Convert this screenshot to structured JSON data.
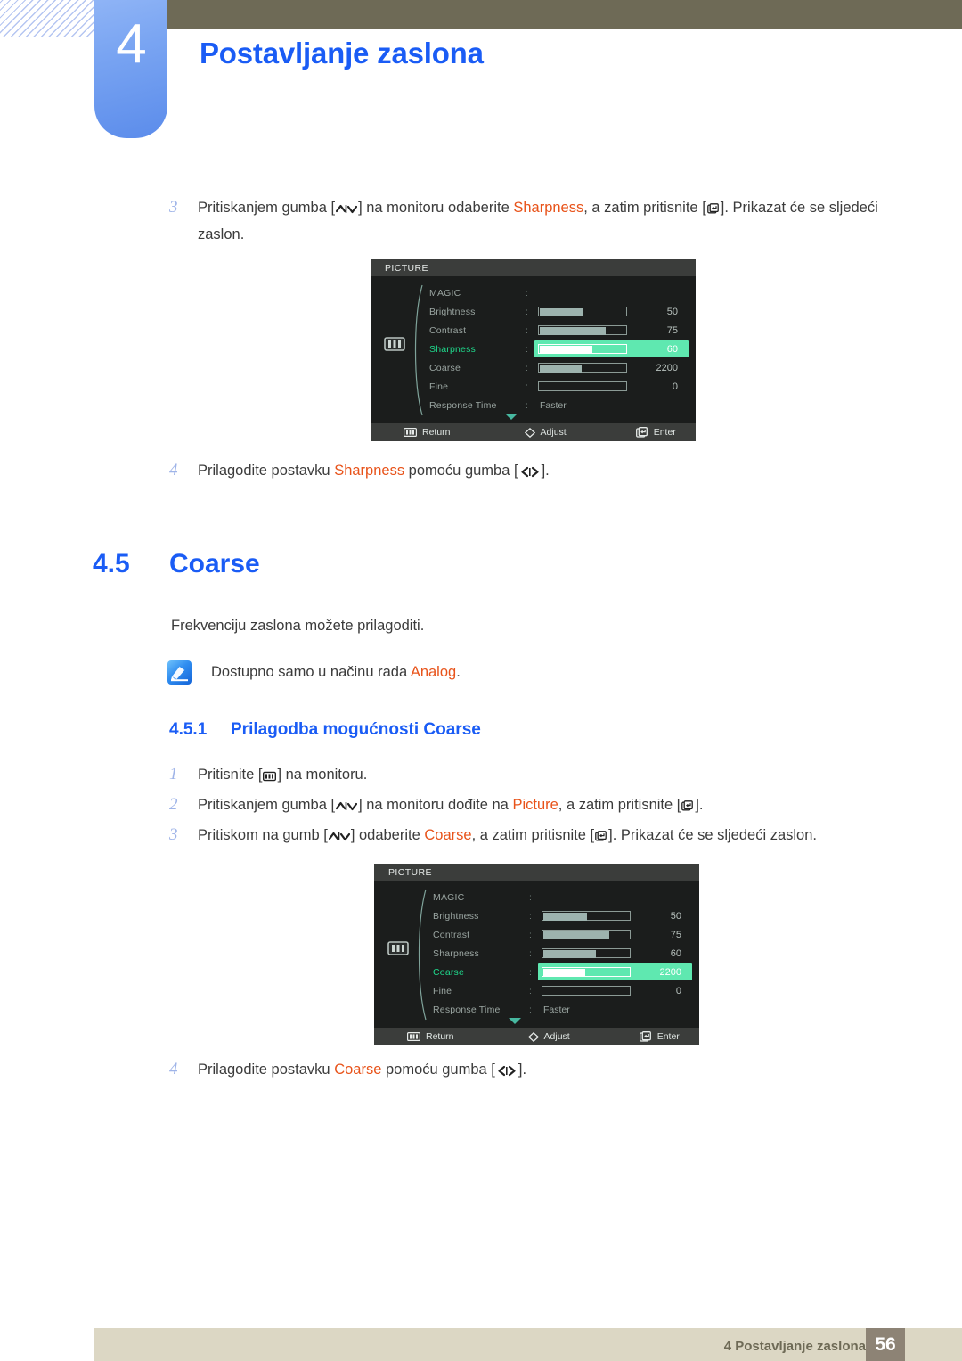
{
  "header": {
    "chapter_number": "4",
    "chapter_title": "Postavljanje zaslona"
  },
  "step_sharpness_3": {
    "number": "3",
    "text_1": "Pritiskanjem gumba [",
    "key_1": "up-down-key",
    "text_2": "] na monitoru odaberite ",
    "highlight_1": "Sharpness",
    "text_3": ", a zatim pritisnite [",
    "key_2": "enter-key",
    "text_4": "]. Prikazat će se sljedeći zaslon."
  },
  "step_sharpness_4": {
    "number": "4",
    "text_1": "Prilagodite postavku ",
    "highlight_1": "Sharpness",
    "text_2": " pomoću gumba [",
    "key_1": "left-right-key",
    "text_3": "]."
  },
  "section": {
    "number": "4.5",
    "title": "Coarse",
    "body": "Frekvenciju zaslona možete prilagoditi.",
    "note_text_1": "Dostupno samo u načinu rada ",
    "note_highlight": "Analog",
    "note_text_2": ".",
    "note_icon": "note-pencil-icon"
  },
  "subsection": {
    "number": "4.5.1",
    "title": "Prilagodba mogućnosti Coarse"
  },
  "steps": [
    {
      "number": "1",
      "text_1": "Pritisnite [",
      "key_1": "menu-key",
      "text_2": "] na monitoru."
    },
    {
      "number": "2",
      "text_1": "Pritiskanjem gumba [",
      "key_1": "up-down-key",
      "text_2": "] na monitoru dođite na ",
      "highlight_1": "Picture",
      "text_3": ", a zatim pritisnite [",
      "key_2": "enter-key",
      "text_4": "]."
    },
    {
      "number": "3",
      "text_1": "Pritiskom na gumb [",
      "key_1": "up-down-key",
      "text_2": "] odaberite ",
      "highlight_1": "Coarse",
      "text_3": ", a zatim pritisnite [",
      "key_2": "enter-key",
      "text_4": "]. Prikazat će se sljedeći zaslon."
    },
    {
      "number": "4",
      "text_1": "Prilagodite postavku ",
      "highlight_1": "Coarse",
      "text_2": " pomoću gumba [",
      "key_1": "left-right-key",
      "text_3": "]."
    }
  ],
  "osd_1": {
    "title": "PICTURE",
    "selected": "Sharpness",
    "rows": [
      {
        "label": "MAGIC",
        "colon": ":",
        "kind": "none",
        "value": "",
        "fill_pct": 0
      },
      {
        "label": "Brightness",
        "colon": ":",
        "kind": "bar",
        "value": "50",
        "fill_pct": 50
      },
      {
        "label": "Contrast",
        "colon": ":",
        "kind": "bar",
        "value": "75",
        "fill_pct": 75
      },
      {
        "label": "Sharpness",
        "colon": ":",
        "kind": "bar",
        "value": "60",
        "fill_pct": 60
      },
      {
        "label": "Coarse",
        "colon": ":",
        "kind": "bar",
        "value": "2200",
        "fill_pct": 48
      },
      {
        "label": "Fine",
        "colon": ":",
        "kind": "bar",
        "value": "0",
        "fill_pct": 0
      },
      {
        "label": "Response Time",
        "colon": ":",
        "kind": "text",
        "value": "Faster",
        "fill_pct": 0
      }
    ],
    "footer": {
      "return_label": "Return",
      "adjust_label": "Adjust",
      "enter_label": "Enter"
    }
  },
  "osd_2": {
    "title": "PICTURE",
    "selected": "Coarse",
    "rows": [
      {
        "label": "MAGIC",
        "colon": ":",
        "kind": "none",
        "value": "",
        "fill_pct": 0
      },
      {
        "label": "Brightness",
        "colon": ":",
        "kind": "bar",
        "value": "50",
        "fill_pct": 50
      },
      {
        "label": "Contrast",
        "colon": ":",
        "kind": "bar",
        "value": "75",
        "fill_pct": 75
      },
      {
        "label": "Sharpness",
        "colon": ":",
        "kind": "bar",
        "value": "60",
        "fill_pct": 60
      },
      {
        "label": "Coarse",
        "colon": ":",
        "kind": "bar",
        "value": "2200",
        "fill_pct": 48
      },
      {
        "label": "Fine",
        "colon": ":",
        "kind": "bar",
        "value": "0",
        "fill_pct": 0
      },
      {
        "label": "Response Time",
        "colon": ":",
        "kind": "text",
        "value": "Faster",
        "fill_pct": 0
      }
    ],
    "footer": {
      "return_label": "Return",
      "adjust_label": "Adjust",
      "enter_label": "Enter"
    }
  },
  "footer": {
    "text": "4 Postavljanje zaslona",
    "page": "56"
  },
  "colors": {
    "accent_blue": "#1a5cf5",
    "highlight_orange": "#e8531a",
    "header_brown": "#6e6a56",
    "tab_blue": "#7aa5f2",
    "osd_green": "#5fe8b0",
    "osd_green_text": "#1fd98c",
    "footer_bar": "#dcd7c4",
    "footer_page_box": "#8d8375"
  }
}
